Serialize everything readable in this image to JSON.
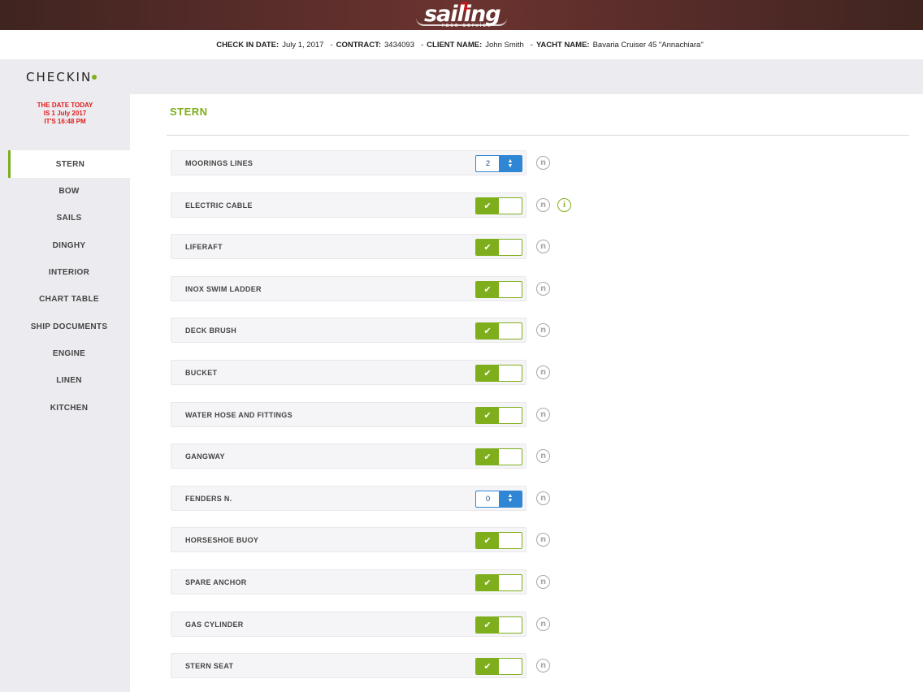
{
  "brand": {
    "logo_text": "sailing",
    "logo_subtext": "race service"
  },
  "infobar": {
    "checkin_date_label": "CHECK IN DATE:",
    "checkin_date": "July 1, 2017",
    "contract_label": "CONTRACT:",
    "contract": "3434093",
    "client_label": "CLIENT NAME:",
    "client": "John Smith",
    "yacht_label": "YACHT NAME:",
    "yacht": "Bavaria Cruiser 45 \"Annachiara\"",
    "separator": "-"
  },
  "sidebar": {
    "title": "CHECKIN",
    "date_line1": "THE DATE TODAY",
    "date_line2": "IS 1 July 2017",
    "date_line3": "IT'S 16:48 PM",
    "items": [
      {
        "label": "STERN"
      },
      {
        "label": "BOW"
      },
      {
        "label": "SAILS"
      },
      {
        "label": "DINGHY"
      },
      {
        "label": "INTERIOR"
      },
      {
        "label": "CHART TABLE"
      },
      {
        "label": "SHIP DOCUMENTS"
      },
      {
        "label": "ENGINE"
      },
      {
        "label": "LINEN"
      },
      {
        "label": "KITCHEN"
      }
    ]
  },
  "section": {
    "title": "STERN",
    "rows": [
      {
        "label": "MOORINGS LINES",
        "control": "stepper",
        "value": "2"
      },
      {
        "label": "ELECTRIC CABLE",
        "control": "toggle",
        "checked": true
      },
      {
        "label": "LIFERAFT",
        "control": "toggle",
        "checked": true
      },
      {
        "label": "INOX SWIM LADDER",
        "control": "toggle",
        "checked": true
      },
      {
        "label": "DECK BRUSH",
        "control": "toggle",
        "checked": true
      },
      {
        "label": "BUCKET",
        "control": "toggle",
        "checked": true
      },
      {
        "label": "WATER HOSE AND FITTINGS",
        "control": "toggle",
        "checked": true
      },
      {
        "label": "GANGWAY",
        "control": "toggle",
        "checked": true
      },
      {
        "label": "FENDERS N.",
        "control": "stepper",
        "value": "0"
      },
      {
        "label": "HORSESHOE BUOY",
        "control": "toggle",
        "checked": true
      },
      {
        "label": "SPARE ANCHOR",
        "control": "toggle",
        "checked": true
      },
      {
        "label": "GAS CYLINDER",
        "control": "toggle",
        "checked": true
      },
      {
        "label": "STERN SEAT",
        "control": "toggle",
        "checked": true
      }
    ]
  },
  "icons": {
    "check": "✔",
    "note": "n",
    "info": "i",
    "stepper_up": "▲",
    "stepper_down": "▼"
  },
  "colors": {
    "accent_green": "#7fae1d",
    "stepper_blue": "#2e86d4",
    "date_red": "#e01b1b"
  }
}
